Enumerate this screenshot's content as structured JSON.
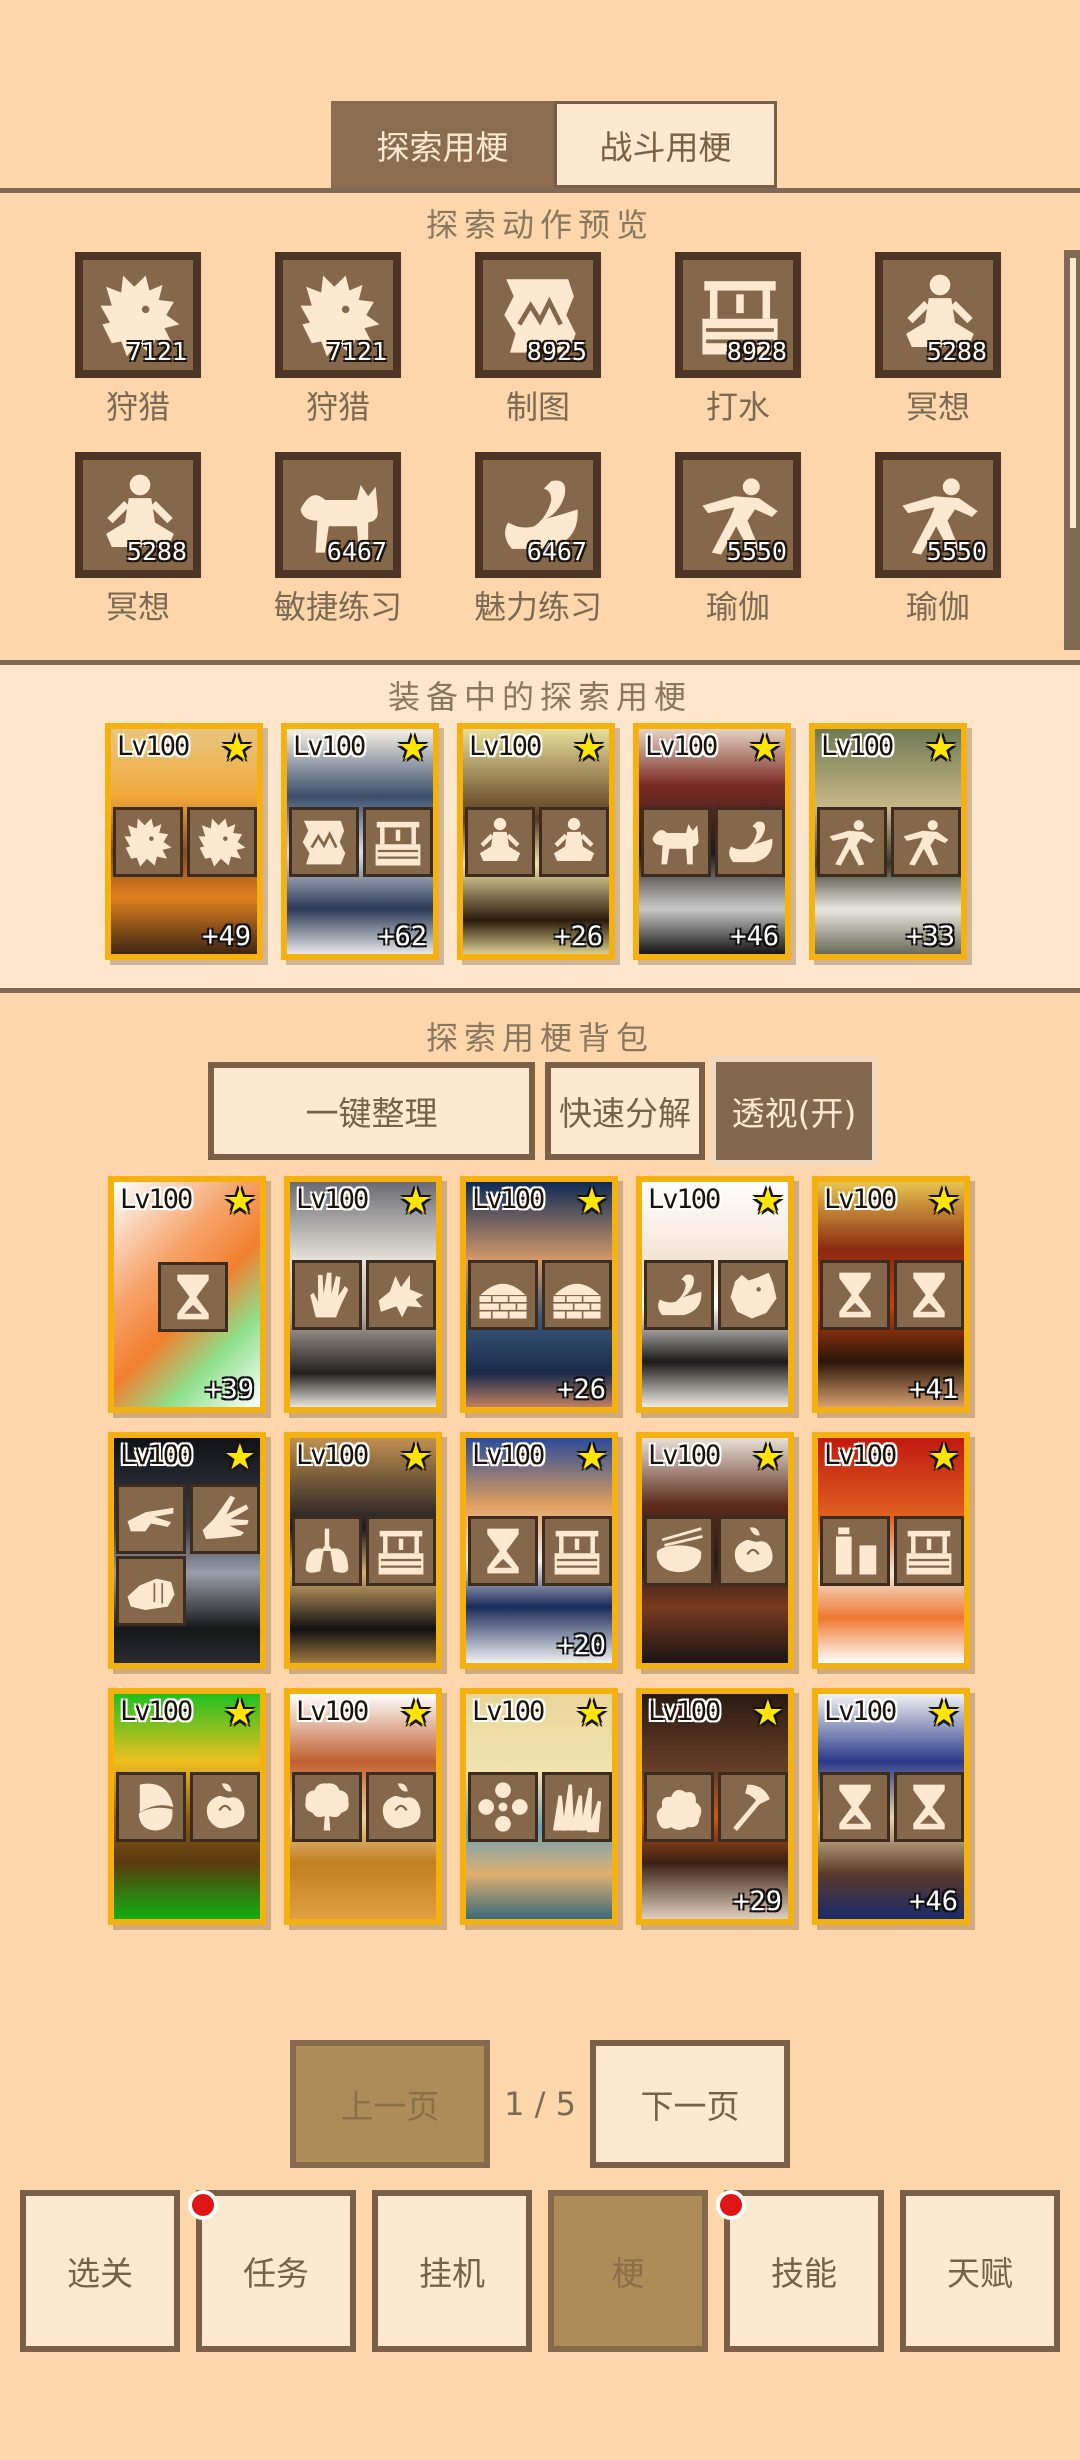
{
  "tabs": {
    "explore": "探索用梗",
    "battle": "战斗用梗"
  },
  "preview": {
    "title": "探索动作预览",
    "actions": [
      {
        "label": "狩猎",
        "count": "7121",
        "icon": "lion-icon"
      },
      {
        "label": "狩猎",
        "count": "7121",
        "icon": "lion-icon"
      },
      {
        "label": "制图",
        "count": "8925",
        "icon": "map-icon"
      },
      {
        "label": "打水",
        "count": "8928",
        "icon": "well-icon"
      },
      {
        "label": "冥想",
        "count": "5288",
        "icon": "meditate-icon"
      },
      {
        "label": "冥想",
        "count": "5288",
        "icon": "meditate-icon"
      },
      {
        "label": "敏捷练习",
        "count": "6467",
        "icon": "cat-icon"
      },
      {
        "label": "魅力练习",
        "count": "6467",
        "icon": "swan-icon"
      },
      {
        "label": "瑜伽",
        "count": "5550",
        "icon": "yoga-icon"
      },
      {
        "label": "瑜伽",
        "count": "5550",
        "icon": "yoga-icon"
      }
    ]
  },
  "equipped": {
    "title": "装备中的探索用梗",
    "cards": [
      {
        "level": "Lv100",
        "bonus": "+49",
        "icons": [
          "lion-icon",
          "lion-icon"
        ]
      },
      {
        "level": "Lv100",
        "bonus": "+62",
        "icons": [
          "map-icon",
          "well-icon"
        ]
      },
      {
        "level": "Lv100",
        "bonus": "+26",
        "icons": [
          "meditate-icon",
          "meditate-icon"
        ]
      },
      {
        "level": "Lv100",
        "bonus": "+46",
        "icons": [
          "cat-icon",
          "swan-icon"
        ]
      },
      {
        "level": "Lv100",
        "bonus": "+33",
        "icons": [
          "yoga-icon",
          "yoga-icon"
        ]
      }
    ]
  },
  "bag": {
    "title": "探索用梗背包",
    "sort_button": "一键整理",
    "decompose_button": "快速分解",
    "xray_button": "透视(开)",
    "cards": [
      {
        "level": "Lv100",
        "bonus": "+39",
        "icons": [
          "hourglass-icon"
        ]
      },
      {
        "level": "Lv100",
        "bonus": "",
        "icons": [
          "hand-icon",
          "wolf-icon"
        ]
      },
      {
        "level": "Lv100",
        "bonus": "+26",
        "icons": [
          "wall-icon",
          "wall-icon"
        ]
      },
      {
        "level": "Lv100",
        "bonus": "",
        "icons": [
          "swan-icon",
          "bear-icon"
        ]
      },
      {
        "level": "Lv100",
        "bonus": "+41",
        "icons": [
          "hourglass-icon",
          "hourglass-icon"
        ]
      },
      {
        "level": "Lv100",
        "bonus": "",
        "icons": [
          "scissors-icon",
          "paper-icon",
          "rock-icon"
        ]
      },
      {
        "level": "Lv100",
        "bonus": "",
        "icons": [
          "lungs-icon",
          "well-icon"
        ]
      },
      {
        "level": "Lv100",
        "bonus": "+20",
        "icons": [
          "hourglass-icon",
          "well-icon"
        ]
      },
      {
        "level": "Lv100",
        "bonus": "",
        "icons": [
          "rice-bowl-icon",
          "fruit-icon"
        ]
      },
      {
        "level": "Lv100",
        "bonus": "",
        "icons": [
          "bottle-icon",
          "well-icon"
        ]
      },
      {
        "level": "Lv100",
        "bonus": "",
        "icons": [
          "acorn-icon",
          "fruit-icon"
        ]
      },
      {
        "level": "Lv100",
        "bonus": "",
        "icons": [
          "tree-icon",
          "fruit-icon"
        ]
      },
      {
        "level": "Lv100",
        "bonus": "",
        "icons": [
          "flower-icon",
          "grass-icon"
        ]
      },
      {
        "level": "Lv100",
        "bonus": "+29",
        "icons": [
          "bush-icon",
          "axe-icon"
        ]
      },
      {
        "level": "Lv100",
        "bonus": "+46",
        "icons": [
          "hourglass-icon",
          "hourglass-icon"
        ]
      }
    ]
  },
  "pager": {
    "prev": "上一页",
    "indicator": "1 / 5",
    "next": "下一页"
  },
  "nav": {
    "items": [
      "选关",
      "任务",
      "挂机",
      "梗",
      "技能",
      "天赋"
    ]
  }
}
